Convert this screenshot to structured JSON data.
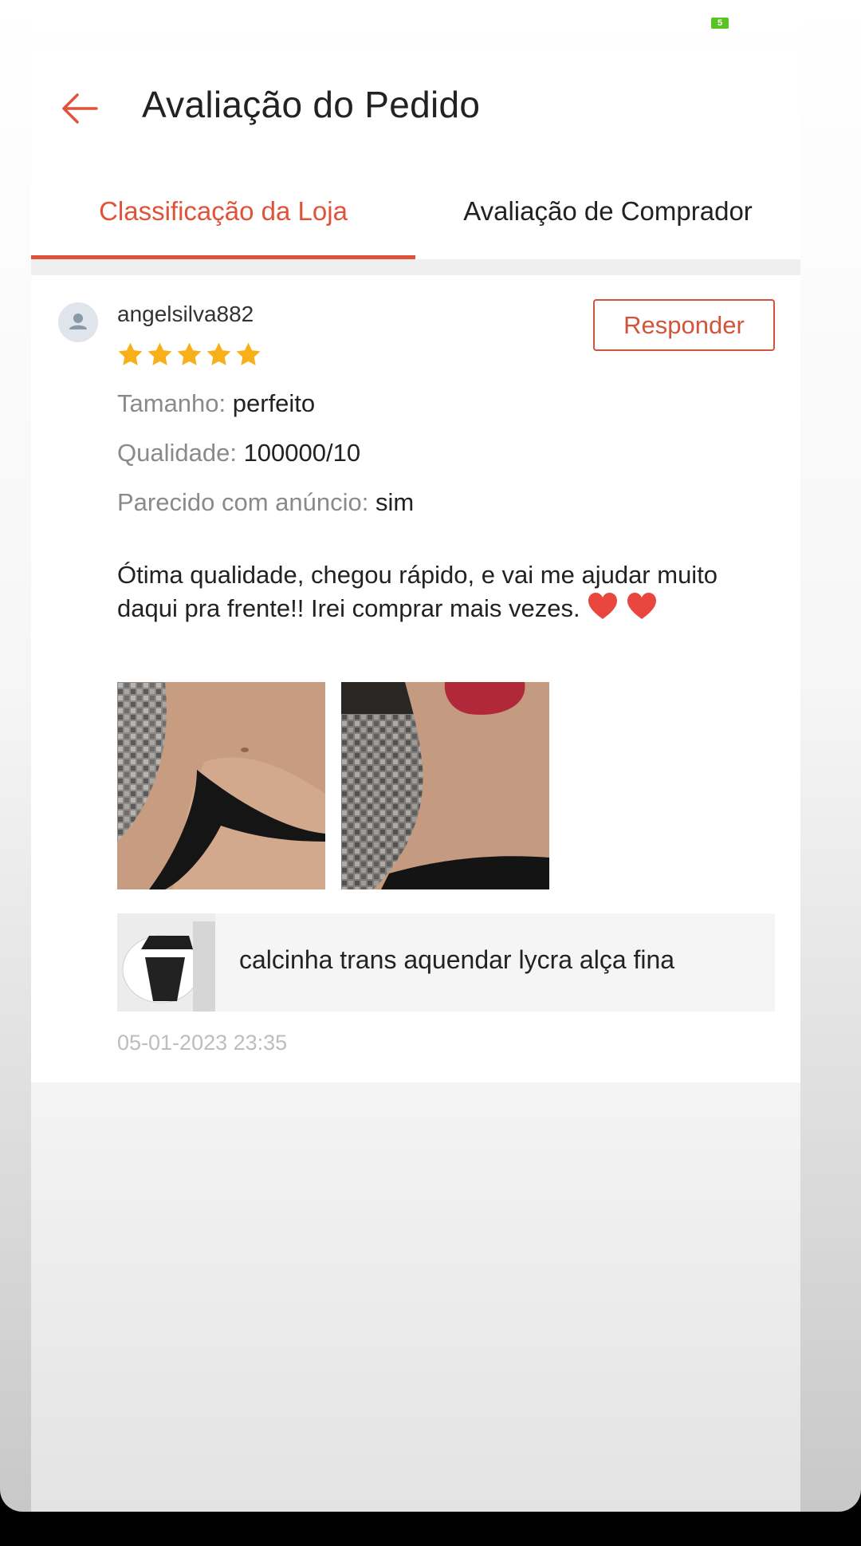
{
  "status_bar": {
    "battery_text": "5"
  },
  "header": {
    "title": "Avaliação do Pedido",
    "back_icon": "arrow-left-icon"
  },
  "tabs": [
    {
      "label": "Classificação da Loja",
      "active": true
    },
    {
      "label": "Avaliação de Comprador",
      "active": false
    }
  ],
  "review": {
    "username": "angelsilva882",
    "reply_label": "Responder",
    "stars": 5,
    "attributes": [
      {
        "label": "Tamanho: ",
        "value": "perfeito"
      },
      {
        "label": "Qualidade: ",
        "value": "100000/10"
      },
      {
        "label": "Parecido com anúncio: ",
        "value": "sim"
      }
    ],
    "comment_text": "Ótima qualidade, chegou rápido, e vai me ajudar muito daqui pra frente!! Irei comprar mais vezes.",
    "product_name": "calcinha trans aquendar lycra alça fina",
    "timestamp": "05-01-2023 23:35"
  },
  "colors": {
    "accent": "#e0533a",
    "star": "#f8b01a",
    "battery": "#58c322"
  }
}
